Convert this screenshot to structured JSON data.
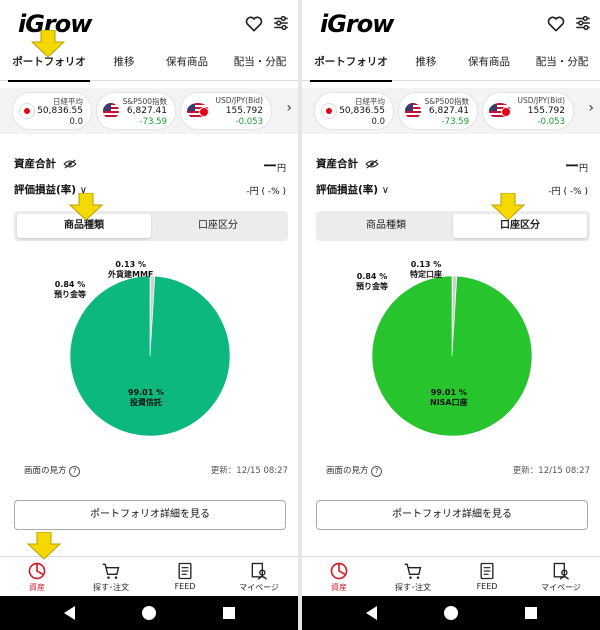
{
  "app": {
    "logo_text": "iGrow"
  },
  "tabs": [
    "ポートフォリオ",
    "推移",
    "保有商品",
    "配当・分配"
  ],
  "tickers": [
    {
      "name": "日経平均",
      "value": "50,836.55",
      "change": "0.0",
      "flag": "jp"
    },
    {
      "name": "S&P500指数",
      "value": "6,827.41",
      "change": "-73.59",
      "flag": "us"
    },
    {
      "name": "USD/JPY(Bid)",
      "value": "155.792",
      "change": "-0.053",
      "flag": "usjp"
    }
  ],
  "summary": {
    "total_label": "資産合計",
    "total_value": "ー",
    "total_unit": "円",
    "pnl_label": "評価損益(率)",
    "pnl_value": "-円 ( -% )"
  },
  "segments": [
    "商品種類",
    "口座区分"
  ],
  "left_pie": {
    "slices": [
      {
        "label": "投資信託",
        "percent": "99.01 %",
        "value": 99.01,
        "color": "#0db87f"
      },
      {
        "label": "預り金等",
        "percent": "0.84 %",
        "value": 0.84,
        "color": "#d0d0d0"
      },
      {
        "label": "外貨建MMF",
        "percent": "0.13 %",
        "value": 0.13,
        "color": "#bdbdbd"
      }
    ]
  },
  "right_pie": {
    "slices": [
      {
        "label": "NISA口座",
        "percent": "99.01 %",
        "value": 99.01,
        "color": "#27c42e"
      },
      {
        "label": "預り金等",
        "percent": "0.84 %",
        "value": 0.84,
        "color": "#d0d0d0"
      },
      {
        "label": "特定口座",
        "percent": "0.13 %",
        "value": 0.13,
        "color": "#bdbdbd"
      }
    ]
  },
  "footer": {
    "howto": "画面の見方",
    "updated": "更新：12/15 08:27",
    "detail_button": "ポートフォリオ詳細を見る"
  },
  "bottom_nav": [
    "資産",
    "探す･注文",
    "FEED",
    "マイページ"
  ],
  "colors": {
    "accent_red": "#d21f2c",
    "highlight_arrow": "#f5d800",
    "negative": "#1e9a2f"
  }
}
